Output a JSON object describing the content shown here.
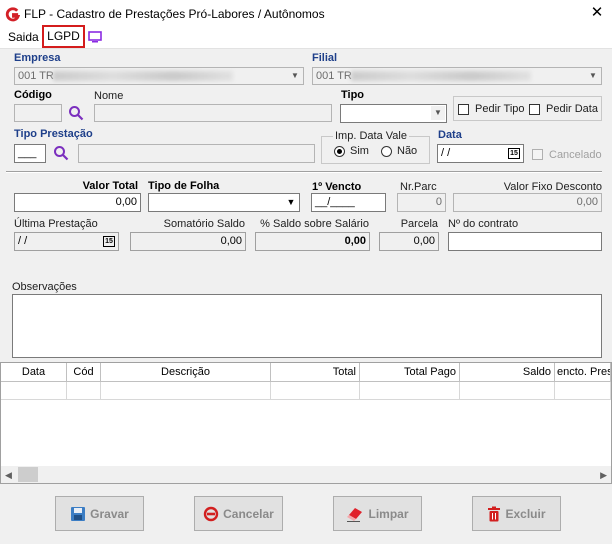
{
  "window": {
    "title": "FLP - Cadastro de Prestações Pró-Labores / Autônomos",
    "close": "✕"
  },
  "menu": {
    "saida": "Saida",
    "lgpd": "LGPD"
  },
  "form": {
    "empresa_label": "Empresa",
    "empresa_value": "001 TR",
    "filial_label": "Filial",
    "filial_value": "001 TR",
    "codigo_label": "Código",
    "nome_label": "Nome",
    "tipo_label": "Tipo",
    "pedir_tipo_label": "Pedir Tipo",
    "pedir_data_label": "Pedir Data",
    "tipo_prestacao_label": "Tipo Prestação",
    "tipo_prestacao_value": "___",
    "imp_data_vale_label": "Imp. Data Vale",
    "sim_label": "Sim",
    "nao_label": "Não",
    "data_label": "Data",
    "data_value": " / /",
    "cancelado_label": "Cancelado",
    "valor_total_label": "Valor Total",
    "valor_total_value": "0,00",
    "tipo_folha_label": "Tipo de Folha",
    "vencto_label": "1º Vencto",
    "vencto_value": "__/____",
    "nr_parc_label": "Nr.Parc",
    "nr_parc_value": "0",
    "valor_fixo_label": "Valor Fixo Desconto",
    "valor_fixo_value": "0,00",
    "ultima_prestacao_label": "Última Prestação",
    "ultima_prestacao_value": " / /",
    "somatorio_label": "Somatório Saldo",
    "somatorio_value": "0,00",
    "pct_saldo_label": "% Saldo sobre Salário",
    "pct_saldo_value": "0,00",
    "parcela_label": "Parcela",
    "parcela_value": "0,00",
    "nr_contrato_label": "Nº do contrato",
    "observacoes_label": "Observações",
    "cal_glyph": "15"
  },
  "grid": {
    "columns": [
      "Data",
      "Cód",
      "Descrição",
      "Total",
      "Total Pago",
      "Saldo",
      "encto. Pres"
    ]
  },
  "buttons": {
    "gravar": "Gravar",
    "cancelar": "Cancelar",
    "limpar": "Limpar",
    "excluir": "Excluir"
  },
  "icons": {
    "app": "app-logo-icon",
    "monitor": "monitor-icon",
    "search": "search-icon",
    "calendar": "calendar-icon",
    "save": "floppy-icon",
    "cancel": "cancel-icon",
    "eraser": "eraser-icon",
    "trash": "trash-icon"
  },
  "colors": {
    "label_blue": "#1e3f8a",
    "lgpd_border": "#d41c1c",
    "search_purple": "#7b2fbe",
    "logo_red": "#d32027"
  }
}
